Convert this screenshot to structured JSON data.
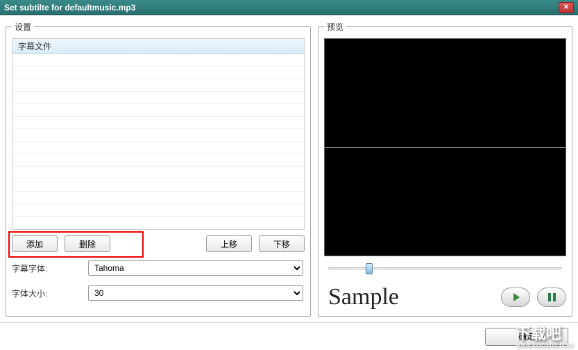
{
  "window": {
    "title": "Set subtilte for defaultmusic.mp3"
  },
  "groups": {
    "settings": "设置",
    "preview": "预览"
  },
  "list": {
    "header": "字幕文件"
  },
  "buttons": {
    "add": "添加",
    "delete": "删除",
    "move_up": "上移",
    "move_down": "下移",
    "ok": "确定"
  },
  "form": {
    "font_label": "字幕字体:",
    "font_value": "Tahoma",
    "size_label": "字体大小:",
    "size_value": "30"
  },
  "preview": {
    "sample_text": "Sample"
  },
  "watermark": {
    "main": "下载吧",
    "sub": "www.xiazaiba.com"
  }
}
